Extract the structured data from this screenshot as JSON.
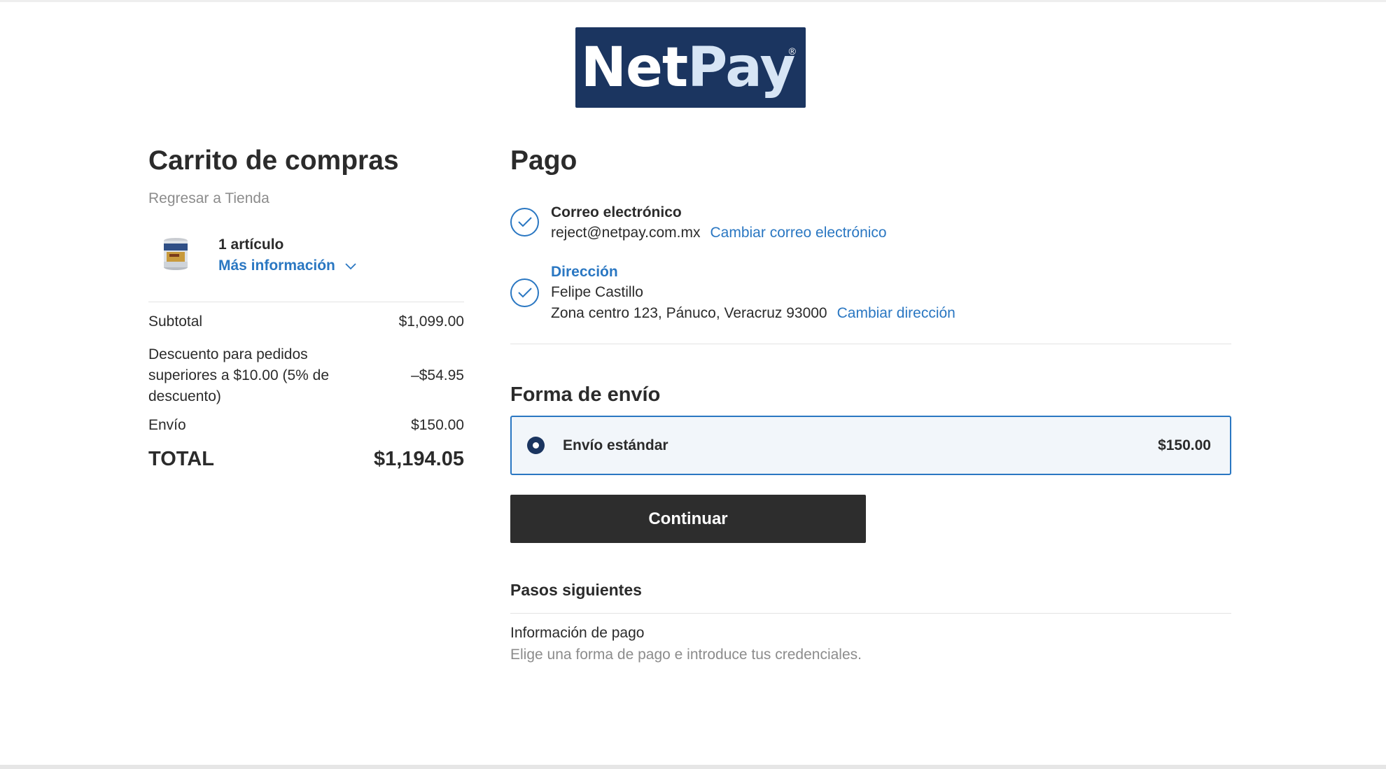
{
  "logo": {
    "text_net": "Net",
    "text_pay": "Pay",
    "registered": "®"
  },
  "cart": {
    "title": "Carrito de compras",
    "back_link": "Regresar a Tienda",
    "items_count": "1 artículo",
    "more_info": "Más información",
    "summary": {
      "subtotal_label": "Subtotal",
      "subtotal_value": "$1,099.00",
      "discount_label": "Descuento para pedidos superiores a $10.00 (5% de descuento)",
      "discount_value": "–$54.95",
      "shipping_label": "Envío",
      "shipping_value": "$150.00",
      "total_label": "TOTAL",
      "total_value": "$1,194.05"
    }
  },
  "payment": {
    "title": "Pago",
    "email": {
      "label": "Correo electrónico",
      "value": "reject@netpay.com.mx",
      "change_link": "Cambiar correo electrónico"
    },
    "address": {
      "label": "Dirección",
      "name": "Felipe Castillo",
      "line": "Zona centro 123, Pánuco, Veracruz 93000",
      "change_link": "Cambiar dirección"
    }
  },
  "shipping": {
    "title": "Forma de envío",
    "option_name": "Envío estándar",
    "option_price": "$150.00",
    "selected": true
  },
  "continue_button": "Continuar",
  "next_steps": {
    "title": "Pasos siguientes",
    "step_title": "Información de pago",
    "step_description": "Elige una forma de pago e introduce tus credenciales."
  },
  "colors": {
    "accent": "#2a77c2",
    "brand_navy": "#1b3560",
    "button": "#2d2d2d",
    "muted_text": "#8c8c8c"
  },
  "icons": [
    "product-thumbnail",
    "chevron-down-icon",
    "check-circle-icon",
    "radio-selected-icon"
  ]
}
